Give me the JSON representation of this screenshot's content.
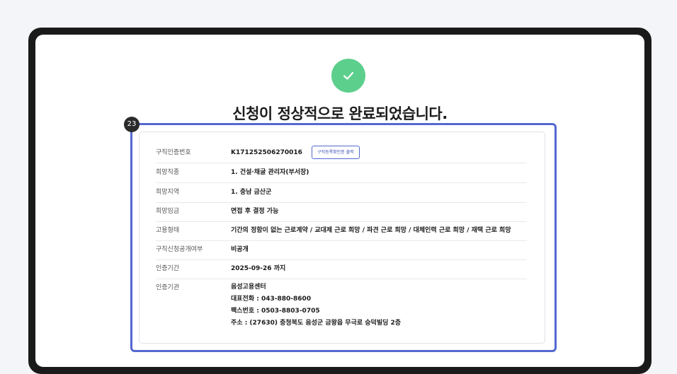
{
  "page": {
    "title": "신청이 정상적으로 완료되었습니다.",
    "badge": "23",
    "check_icon": "check-icon",
    "colors": {
      "success": "#5ccf8c",
      "highlight": "#5468d0",
      "frame": "#1a1a1a"
    }
  },
  "details": {
    "cert_number": {
      "label": "구직인증번호",
      "value": "K171252506270016",
      "print_button": "구직등록확인증 출력"
    },
    "desired_job": {
      "label": "희망직종",
      "value": "1. 건설·채굴 관리자(부서장)"
    },
    "desired_region": {
      "label": "희망지역",
      "value": "1. 충남 금산군"
    },
    "desired_wage": {
      "label": "희망임금",
      "value": "면접 후 결정 가능"
    },
    "employment_type": {
      "label": "고용형태",
      "value": "기간의 정함이 없는 근로계약 / 교대제 근로 희망 / 파견 근로 희망 / 대체인력 근로 희망 / 재택 근로 희망"
    },
    "disclosure": {
      "label": "구직신청공개여부",
      "value": "비공개"
    },
    "cert_period": {
      "label": "인증기간",
      "value": "2025-09-26 까지"
    },
    "cert_agency": {
      "label": "인증기관",
      "name": "음성고용센터",
      "phone": "대표전화 : 043-880-8600",
      "fax": "팩스번호 : 0503-8803-0705",
      "address": "주소 : (27630) 충청북도 음성군 금왕읍 무극로 승덕빌딩 2층"
    }
  }
}
